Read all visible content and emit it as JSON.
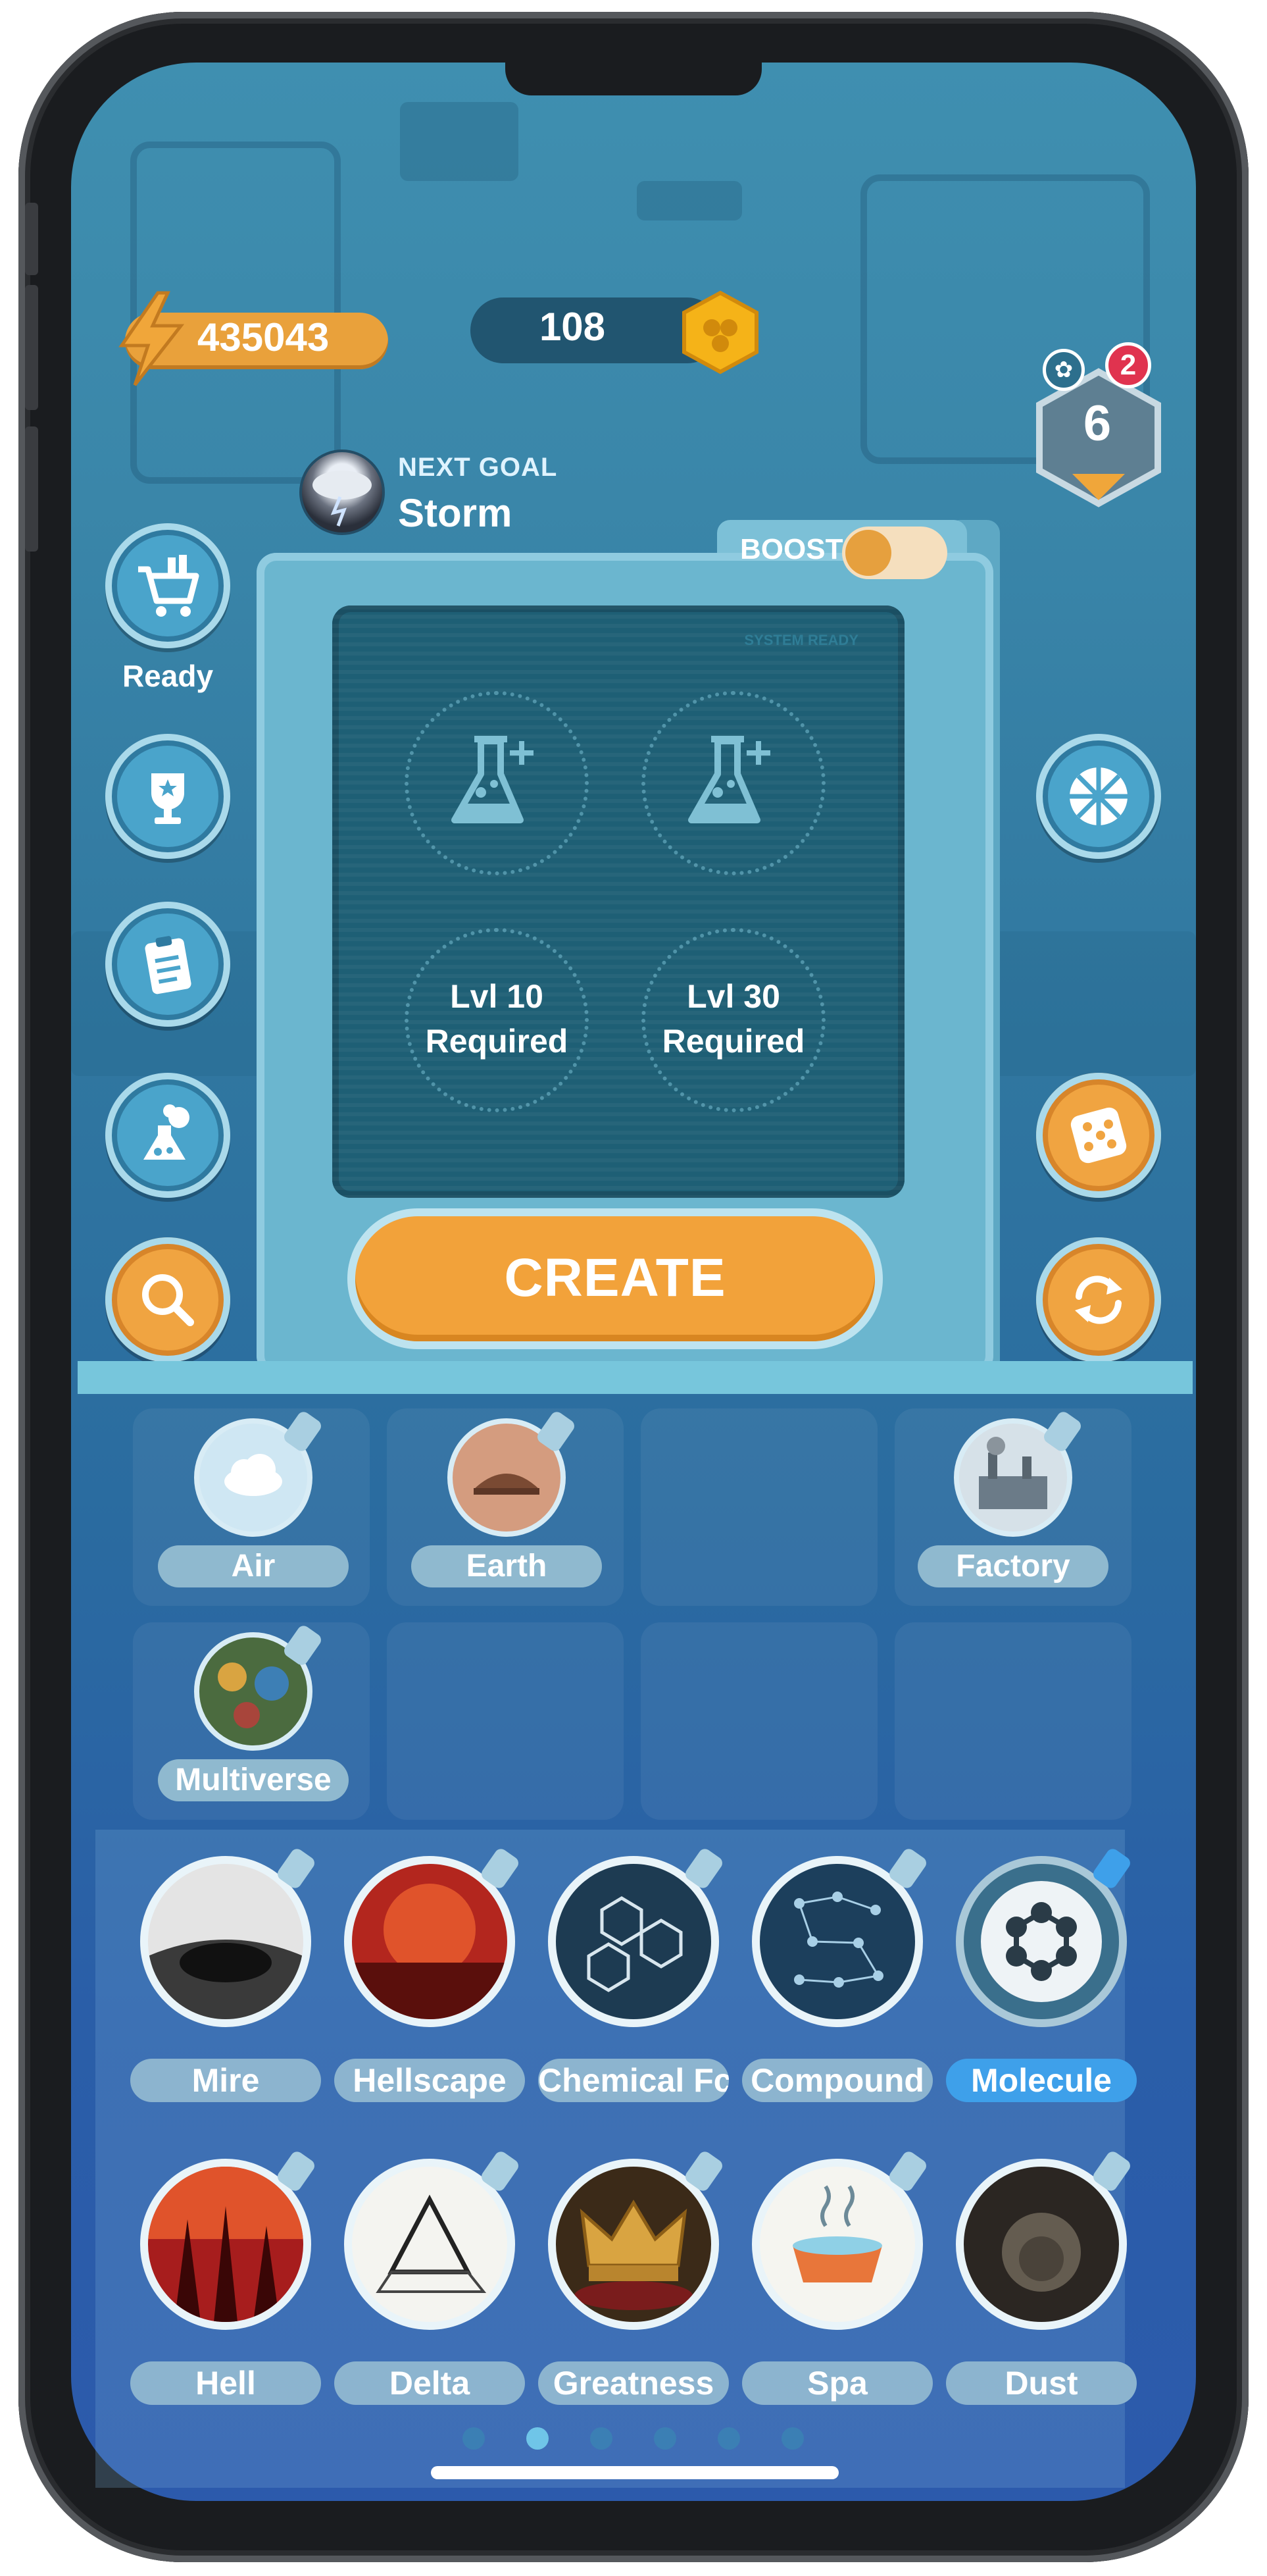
{
  "energy": "435043",
  "coins": "108",
  "level": "6",
  "notifications": "2",
  "next_goal": {
    "label": "NEXT GOAL",
    "name": "Storm"
  },
  "left_buttons": [
    {
      "icon": "shop-cart-icon",
      "label": "Ready"
    },
    {
      "icon": "trophy-icon"
    },
    {
      "icon": "clipboard-icon"
    },
    {
      "icon": "flask-explosion-icon"
    },
    {
      "icon": "search-icon"
    }
  ],
  "right_buttons": [
    {
      "icon": "prize-wheel-icon"
    },
    {
      "icon": "dice-icon"
    },
    {
      "icon": "refresh-icon"
    }
  ],
  "machine": {
    "boost_label": "BOOST",
    "status": "SYSTEM READY",
    "slots": [
      {
        "type": "flask"
      },
      {
        "type": "flask"
      },
      {
        "line1": "Lvl 10",
        "line2": "Required"
      },
      {
        "line1": "Lvl 30",
        "line2": "Required"
      }
    ],
    "create_label": "CREATE"
  },
  "inventory": [
    {
      "name": "Air",
      "color": "#cfe7f3"
    },
    {
      "name": "Earth",
      "color": "#d49c7f"
    },
    {
      "name": "Factory",
      "color": "#c9d6df"
    },
    {
      "name": "Multiverse",
      "color": "#4b6b3f"
    }
  ],
  "elements": [
    {
      "name": "Mire",
      "color": "#222222"
    },
    {
      "name": "Hellscape",
      "color": "#b3261e"
    },
    {
      "name": "Chemical Fc",
      "color": "#1d3b52"
    },
    {
      "name": "Compound",
      "color": "#1c3f5c"
    },
    {
      "name": "Molecule",
      "color": "#3a6f8c",
      "active": true
    },
    {
      "name": "Hell",
      "color": "#a71d1d"
    },
    {
      "name": "Delta",
      "color": "#f4f4f0"
    },
    {
      "name": "Greatness",
      "color": "#5a3b1c"
    },
    {
      "name": "Spa",
      "color": "#f5f5f0"
    },
    {
      "name": "Dust",
      "color": "#2b2622"
    }
  ],
  "pagination": {
    "pages": 6,
    "active": 2
  },
  "colors": {
    "accent": "#f2a23a",
    "panel": "#1e5f75",
    "active_tab": "#3ea0ea"
  }
}
